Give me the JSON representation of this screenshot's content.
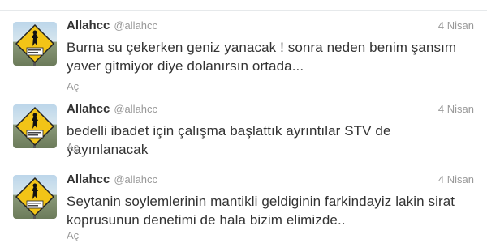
{
  "tweets": [
    {
      "name": "Allahcc",
      "handle": "@allahcc",
      "time": "4 Nisan",
      "text": "Burna su çekerken geniz yanacak ! sonra neden benim şansım yaver gitmiyor diye dolanırsın ortada...",
      "expand": "Aç"
    },
    {
      "name": "Allahcc",
      "handle": "@allahcc",
      "time": "4 Nisan",
      "text": "bedelli ibadet için çalışma başlattık ayrıntılar STV de yayınlanacak",
      "expand": "Aç"
    },
    {
      "name": "Allahcc",
      "handle": "@allahcc",
      "time": "4 Nisan",
      "text": "Seytanin soylemlerinin mantikli geldiginin farkindayiz lakin sirat koprusunun denetimi de hala bizim elimizde..",
      "expand": "Aç"
    }
  ],
  "avatar_sign_text": "",
  "colors": {
    "name": "#333333",
    "meta": "#999999",
    "text": "#333333",
    "sign": "#f2c417",
    "divider": "#e6e9eb"
  }
}
